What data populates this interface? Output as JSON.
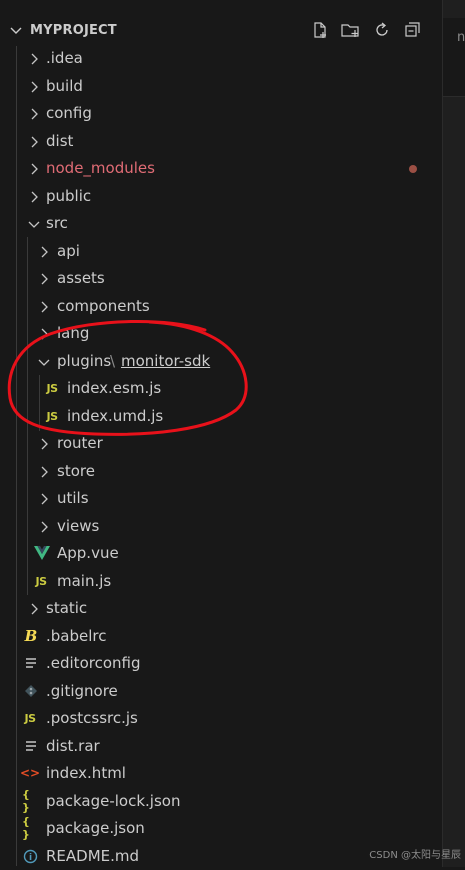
{
  "explorer": {
    "section_title": "MYPROJECT",
    "top_partial_text": "··· ···· ·· ···",
    "actions": [
      {
        "name": "new-file-icon"
      },
      {
        "name": "new-folder-icon"
      },
      {
        "name": "refresh-icon"
      },
      {
        "name": "collapse-all-icon"
      }
    ],
    "tree": {
      "idea": ".idea",
      "build": "build",
      "config": "config",
      "dist": "dist",
      "node_modules": "node_modules",
      "public": "public",
      "src": "src",
      "api": "api",
      "assets": "assets",
      "components": "components",
      "lang": "lang",
      "plugins": "plugins",
      "plugins_sep": "\\",
      "monitor_sdk": "monitor-sdk",
      "index_esm": "index.esm.js",
      "index_umd": "index.umd.js",
      "router": "router",
      "store": "store",
      "utils": "utils",
      "views": "views",
      "app_vue": "App.vue",
      "main_js": "main.js",
      "static": "static",
      "babelrc": ".babelrc",
      "editorconfig": ".editorconfig",
      "gitignore": ".gitignore",
      "postcssrc": ".postcssrc.js",
      "dist_rar": "dist.rar",
      "index_html": "index.html",
      "package_lock": "package-lock.json",
      "package_json": "package.json",
      "readme": "README.md"
    },
    "icons": {
      "js": "JS",
      "json": "{ }",
      "html": "<>",
      "readme": "i",
      "babel": "B",
      "vue": "V"
    }
  },
  "right_strip_char": "n",
  "watermark": "CSDN @太阳与星辰",
  "colors": {
    "background": "#181818",
    "text": "#cccccc",
    "node_modules": "#e06c75",
    "modified_dot": "#9b4f44",
    "js_icon": "#cbcb41",
    "json_icon": "#cbcb41",
    "html_icon": "#e44d26",
    "vue_icon": "#41b883",
    "readme_icon": "#519aba",
    "babel_icon": "#f5da55",
    "annotation": "#e8111a"
  }
}
